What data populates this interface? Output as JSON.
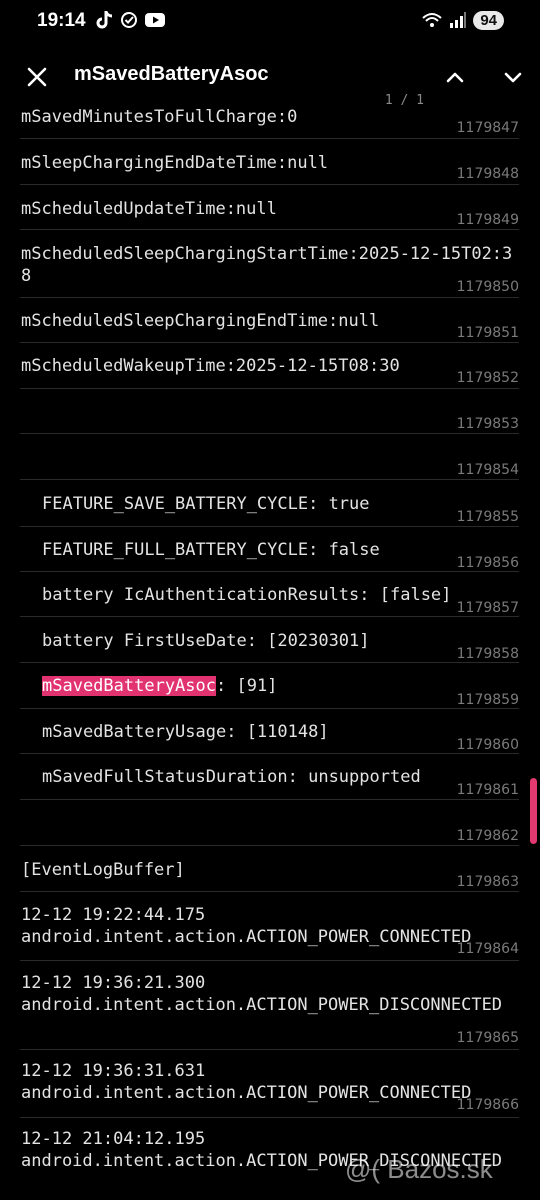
{
  "status_bar": {
    "time": "19:14",
    "battery": "94",
    "left_icons": [
      "tiktok-icon",
      "check-circle-icon",
      "youtube-icon"
    ],
    "right_icons": [
      "wifi-icon",
      "signal-icon"
    ]
  },
  "toolbar": {
    "title": "mSavedBatteryAsoc",
    "match_count": "1 / 1"
  },
  "log_rows": [
    {
      "text": "mSavedMinutesToFullCharge:0",
      "num": "1179847"
    },
    {
      "text": "mSleepChargingEndDateTime:null",
      "num": "1179848"
    },
    {
      "text": "mScheduledUpdateTime:null",
      "num": "1179849"
    },
    {
      "text": "mScheduledSleepChargingStartTime:2025-12-15T02:38",
      "num": "1179850"
    },
    {
      "text": "mScheduledSleepChargingEndTime:null",
      "num": "1179851"
    },
    {
      "text": "mScheduledWakeupTime:2025-12-15T08:30",
      "num": "1179852"
    },
    {
      "text": "",
      "num": "1179853"
    },
    {
      "text": "",
      "num": "1179854"
    },
    {
      "text": "FEATURE_SAVE_BATTERY_CYCLE: true",
      "num": "1179855"
    },
    {
      "text": "FEATURE_FULL_BATTERY_CYCLE: false",
      "num": "1179856"
    },
    {
      "text": "battery IcAuthenticationResults: [false]",
      "num": "1179857"
    },
    {
      "text": "battery FirstUseDate: [20230301]",
      "num": "1179858"
    },
    {
      "highlight": "mSavedBatteryAsoc",
      "rest": ": [91]",
      "num": "1179859"
    },
    {
      "text": "mSavedBatteryUsage: [110148]",
      "num": "1179860"
    },
    {
      "text": "mSavedFullStatusDuration: unsupported",
      "num": "1179861"
    },
    {
      "text": "",
      "num": "1179862"
    },
    {
      "text": "[EventLogBuffer]",
      "num": "1179863"
    },
    {
      "text": "12-12 19:22:44.175\nandroid.intent.action.ACTION_POWER_CONNECTED",
      "num": "1179864"
    },
    {
      "text": "12-12 19:36:21.300\nandroid.intent.action.ACTION_POWER_DISCONNECTED",
      "num": "1179865"
    },
    {
      "text": "12-12 19:36:31.631\nandroid.intent.action.ACTION_POWER_CONNECTED",
      "num": "1179866"
    },
    {
      "text": "12-12 21:04:12.195\nandroid.intent.action.ACTION_POWER_DISCONNECTED",
      "num": ""
    }
  ],
  "watermark": "@( Bazos.sk",
  "colors": {
    "highlight": "#e0336f",
    "scrollbar": "#e23a70",
    "background": "#000000"
  }
}
